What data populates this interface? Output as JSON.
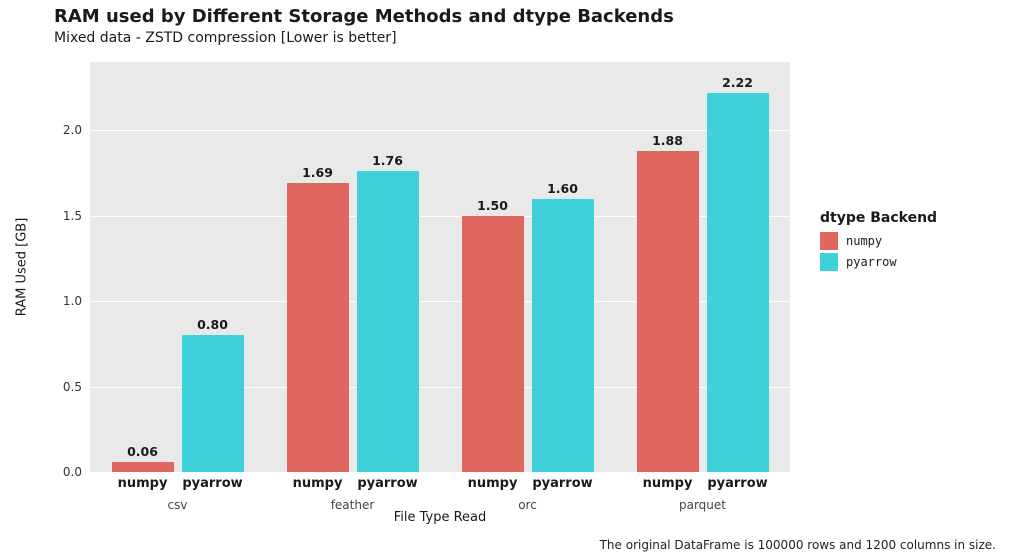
{
  "title": "RAM used by Different Storage Methods and dtype Backends",
  "subtitle": "Mixed data - ZSTD compression [Lower is better]",
  "ylabel": "RAM Used [GB]",
  "xlabel": "File Type Read",
  "caption": "The original DataFrame is 100000 rows and 1200 columns in size.",
  "legend": {
    "title": "dtype Backend",
    "items": [
      "numpy",
      "pyarrow"
    ]
  },
  "yticks": [
    "0.0",
    "0.5",
    "1.0",
    "1.5",
    "2.0"
  ],
  "chart_data": {
    "type": "bar",
    "categories": [
      "csv",
      "feather",
      "orc",
      "parquet"
    ],
    "series": [
      {
        "name": "numpy",
        "values": [
          0.06,
          1.69,
          1.5,
          1.88
        ]
      },
      {
        "name": "pyarrow",
        "values": [
          0.8,
          1.76,
          1.6,
          2.22
        ]
      }
    ],
    "value_labels": {
      "numpy": [
        "0.06",
        "1.69",
        "1.50",
        "1.88"
      ],
      "pyarrow": [
        "0.80",
        "1.76",
        "1.60",
        "2.22"
      ]
    },
    "ylabel": "RAM Used [GB]",
    "xlabel": "File Type Read",
    "ylim": [
      0,
      2.4
    ],
    "title": "RAM used by Different Storage Methods and dtype Backends"
  }
}
